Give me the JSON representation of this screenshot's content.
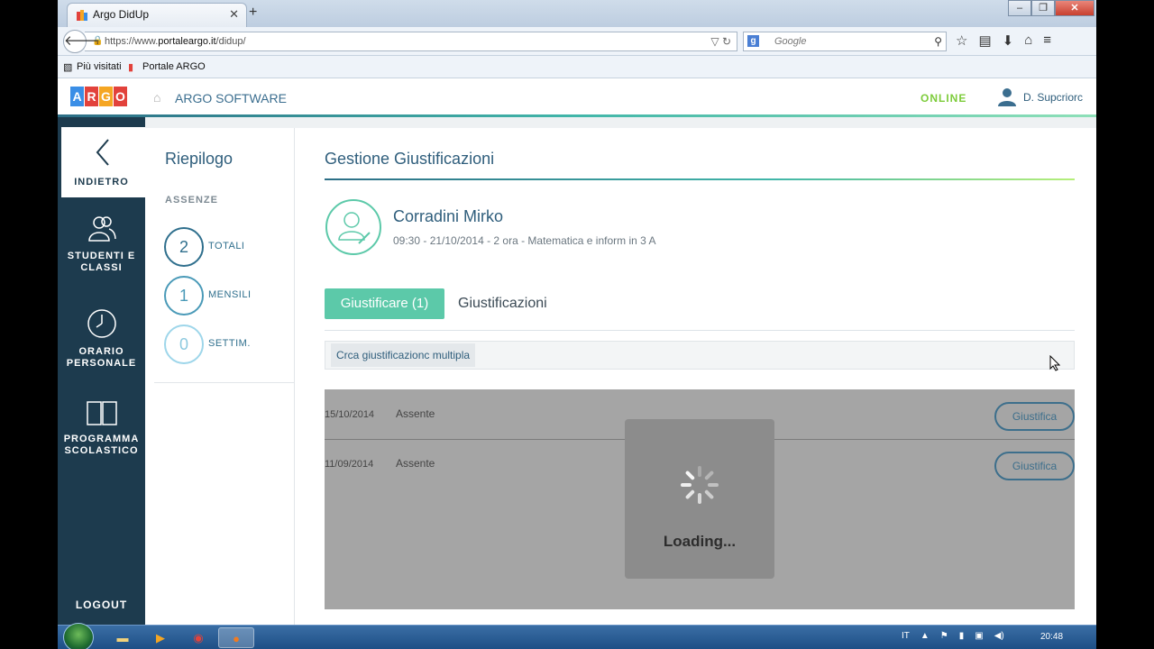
{
  "browser": {
    "tab_title": "Argo DidUp",
    "url_prefix": "https://www.",
    "url_host": "portaleargo.it",
    "url_path": "/didup/",
    "search_placeholder": "Google",
    "bookmarks": [
      "Più visitati",
      "Portale ARGO"
    ]
  },
  "header": {
    "logo_letters": [
      "A",
      "R",
      "G",
      "O"
    ],
    "logo_colors": [
      "#3a8ee6",
      "#e2423b",
      "#f5a623",
      "#e2423b"
    ],
    "brand": "ARGO SOFTWARE",
    "status": "ONLINE",
    "user": "D. Supcriorc"
  },
  "sidebar": {
    "back_label": "INDIETRO",
    "items": [
      {
        "label": "STUDENTI E CLASSI",
        "icon": "users-icon"
      },
      {
        "label": "ORARIO PERSONALE",
        "icon": "clock-icon"
      },
      {
        "label": "PROGRAMMA SCOLASTICO",
        "icon": "book-icon"
      }
    ],
    "logout": "LOGOUT"
  },
  "summary": {
    "title": "Riepilogo",
    "section": "ASSENZE",
    "counts": [
      {
        "value": "2",
        "label": "TOTALI"
      },
      {
        "value": "1",
        "label": "MENSILI"
      },
      {
        "value": "0",
        "label": "SETTIM."
      }
    ]
  },
  "main": {
    "title": "Gestione Giustificazioni",
    "student_name": "Corradini Mirko",
    "student_info": "09:30 - 21/10/2014 - 2 ora - Matematica e inform in 3 A",
    "tab_active": "Giustificare (1)",
    "tab_inactive": "Giustificazioni",
    "multi_button": "Crca giustificazionc multipla",
    "rows": [
      {
        "date": "15/10/2014",
        "type": "Assente",
        "action": "Giustifica"
      },
      {
        "date": "11/09/2014",
        "type": "Assente",
        "action": "Giustifica"
      }
    ],
    "loading": "Loading..."
  },
  "taskbar": {
    "lang": "IT",
    "time": "20:48"
  }
}
